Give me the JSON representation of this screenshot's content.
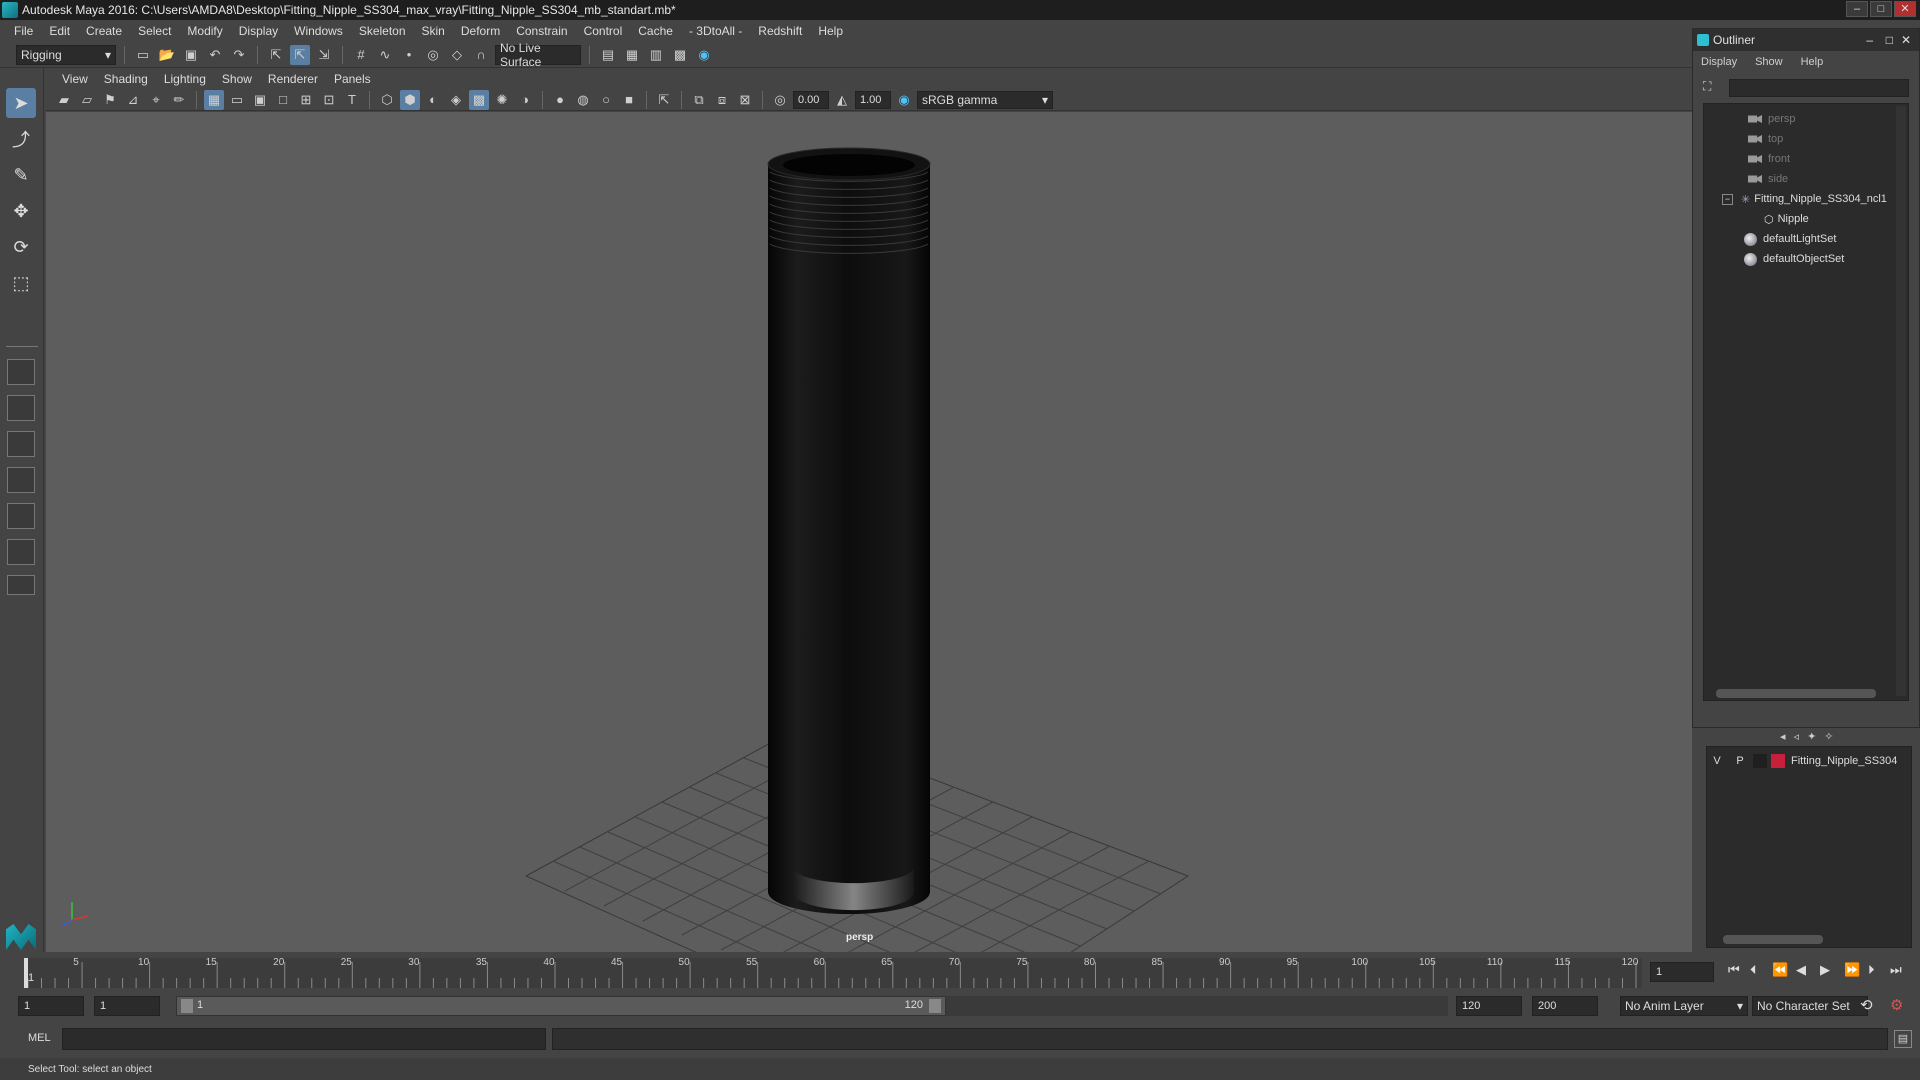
{
  "window": {
    "title": "Autodesk Maya 2016: C:\\Users\\AMDA8\\Desktop\\Fitting_Nipple_SS304_max_vray\\Fitting_Nipple_SS304_mb_standart.mb*"
  },
  "menubar": [
    "File",
    "Edit",
    "Create",
    "Select",
    "Modify",
    "Display",
    "Windows",
    "Skeleton",
    "Skin",
    "Deform",
    "Constrain",
    "Control",
    "Cache",
    "- 3DtoAll -",
    "Redshift",
    "Help"
  ],
  "shelf": {
    "menuset": "Rigging",
    "live_surface": "No Live Surface"
  },
  "viewport": {
    "menus": [
      "View",
      "Shading",
      "Lighting",
      "Show",
      "Renderer",
      "Panels"
    ],
    "exposure": "0.00",
    "gamma": "1.00",
    "colorspace": "sRGB gamma",
    "camera_label": "persp"
  },
  "outliner": {
    "title": "Outliner",
    "menus": [
      "Display",
      "Show",
      "Help"
    ],
    "items": [
      {
        "label": "persp",
        "kind": "camera",
        "dim": true
      },
      {
        "label": "top",
        "kind": "camera",
        "dim": true
      },
      {
        "label": "front",
        "kind": "camera",
        "dim": true
      },
      {
        "label": "side",
        "kind": "camera",
        "dim": true
      },
      {
        "label": "Fitting_Nipple_SS304_ncl1",
        "kind": "group",
        "expanded": true
      },
      {
        "label": "Nipple",
        "kind": "mesh",
        "child": true
      },
      {
        "label": "defaultLightSet",
        "kind": "set"
      },
      {
        "label": "defaultObjectSet",
        "kind": "set"
      }
    ]
  },
  "layers": [
    {
      "v": "V",
      "p": "P",
      "color": "#c8203c",
      "name": "Fitting_Nipple_SS304"
    }
  ],
  "timeline": {
    "ticks": [
      "5",
      "10",
      "15",
      "20",
      "25",
      "30",
      "35",
      "40",
      "45",
      "50",
      "55",
      "60",
      "65",
      "70",
      "75",
      "80",
      "85",
      "90",
      "95",
      "100",
      "105",
      "110",
      "115",
      "120"
    ],
    "start_marker": "1",
    "current_frame": "1"
  },
  "range": {
    "start": "1",
    "playback_start": "1",
    "slider_start": "1",
    "slider_end": "120",
    "playback_end": "120",
    "end": "200",
    "anim_layer": "No Anim Layer",
    "character_set": "No Character Set"
  },
  "command": {
    "lang": "MEL"
  },
  "status": {
    "help": "Select Tool: select an object"
  }
}
